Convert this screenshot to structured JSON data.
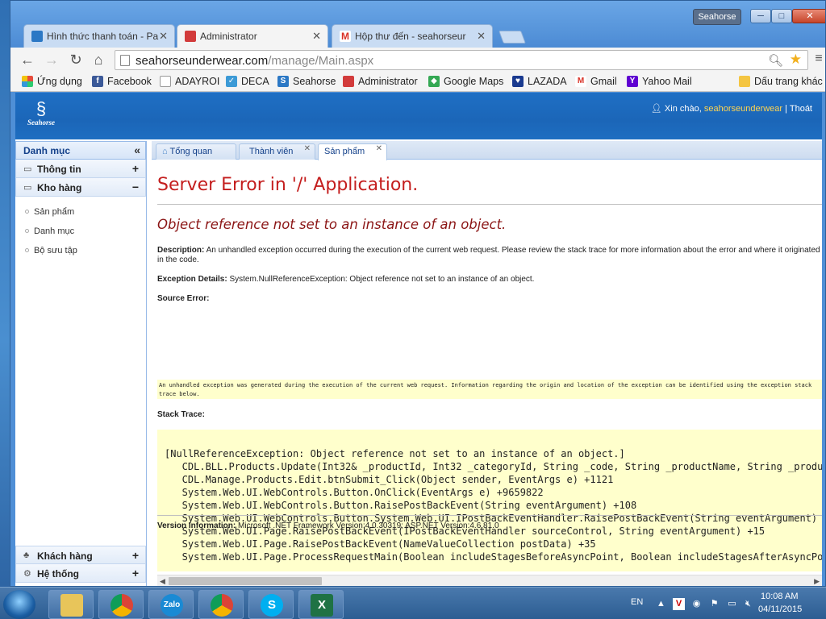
{
  "window": {
    "profile": "Seahorse",
    "controls": {
      "minimize": "─",
      "maximize": "□",
      "close": "✕"
    }
  },
  "tabs": [
    {
      "title": "Hình thức thanh toán - Pa",
      "icon": "seahorse-icon"
    },
    {
      "title": "Administrator",
      "icon": "admin-icon"
    },
    {
      "title": "Hộp thư đến - seahorseur",
      "icon": "gmail-icon"
    }
  ],
  "address_bar": {
    "host": "seahorseunderwear.com",
    "path": "/manage/Main.aspx"
  },
  "bookmarks": [
    {
      "label": "Ứng dụng",
      "icon": "apps-icon"
    },
    {
      "label": "Facebook",
      "icon": "facebook-icon"
    },
    {
      "label": "ADAYROI",
      "icon": "page-icon"
    },
    {
      "label": "DECA",
      "icon": "deca-icon"
    },
    {
      "label": "Seahorse",
      "icon": "seahorse-icon"
    },
    {
      "label": "Administrator",
      "icon": "admin-icon"
    },
    {
      "label": "Google Maps",
      "icon": "maps-icon"
    },
    {
      "label": "LAZADA",
      "icon": "lazada-icon"
    },
    {
      "label": "Gmail",
      "icon": "gmail-icon"
    },
    {
      "label": "Yahoo Mail",
      "icon": "yahoo-icon"
    },
    {
      "label": "Dấu trang khác",
      "icon": "folder-icon"
    }
  ],
  "app_header": {
    "brand": "Seahorse",
    "greeting": "Xin chào, ",
    "username": "seahorseunderwear",
    "separator": " | ",
    "logout": "Thoát"
  },
  "sidebar": {
    "title": "Danh mục",
    "collapse": "«",
    "sections": [
      {
        "label": "Thông tin",
        "toggle": "+",
        "icon": "monitor-icon"
      },
      {
        "label": "Kho hàng",
        "toggle": "−",
        "icon": "monitor-icon"
      }
    ],
    "items": [
      "Sản phẩm",
      "Danh mục",
      "Bộ sưu tập"
    ],
    "bottom_sections": [
      {
        "label": "Khách hàng",
        "toggle": "+",
        "icon": "users-icon"
      },
      {
        "label": "Hệ thống",
        "toggle": "+",
        "icon": "gear-icon"
      }
    ]
  },
  "content_tabs": [
    {
      "label": "Tổng quan",
      "closable": false
    },
    {
      "label": "Thành viên",
      "closable": true
    },
    {
      "label": "Sản phẩm",
      "closable": true
    }
  ],
  "error": {
    "title": "Server Error in '/' Application.",
    "subtitle": "Object reference not set to an instance of an object.",
    "description_label": "Description:",
    "description_text": " An unhandled exception occurred during the execution of the current web request. Please review the stack trace for more information about the error and where it originated in the code.",
    "exception_label": "Exception Details:",
    "exception_text": " System.NullReferenceException: Object reference not set to an instance of an object.",
    "source_label": "Source Error:",
    "source_text": "An unhandled exception was generated during the execution of the current web request. Information regarding the origin and location of the exception can be identified using the exception stack trace below.",
    "stack_label": "Stack Trace:",
    "stack_lines": [
      "[NullReferenceException: Object reference not set to an instance of an object.]",
      "   CDL.BLL.Products.Update(Int32& _productId, Int32 _categoryId, String _code, String _productName, String _produ",
      "   CDL.Manage.Products.Edit.btnSubmit_Click(Object sender, EventArgs e) +1121",
      "   System.Web.UI.WebControls.Button.OnClick(EventArgs e) +9659822",
      "   System.Web.UI.WebControls.Button.RaisePostBackEvent(String eventArgument) +108",
      "   System.Web.UI.WebControls.Button.System.Web.UI.IPostBackEventHandler.RaisePostBackEvent(String eventArgument) +",
      "   System.Web.UI.Page.RaisePostBackEvent(IPostBackEventHandler sourceControl, String eventArgument) +15",
      "   System.Web.UI.Page.RaisePostBackEvent(NameValueCollection postData) +35",
      "   System.Web.UI.Page.ProcessRequestMain(Boolean includeStagesBeforeAsyncPoint, Boolean includeStagesAfterAsyncPo"
    ],
    "version_label": "Version Information:",
    "version_text": " Microsoft .NET Framework Version:4.0.30319; ASP.NET Version:4.6.81.0"
  },
  "taskbar": {
    "apps": [
      "explorer-icon",
      "chrome-icon",
      "zalo-icon",
      "chrome-icon",
      "skype-icon",
      "excel-icon"
    ],
    "zalo_label": "Zalo",
    "skype_label": "S",
    "excel_label": "X",
    "language": "EN",
    "time": "10:08 AM",
    "date": "04/11/2015"
  },
  "colors": {
    "error_red": "#c41e1e",
    "header_blue": "#1f6fc4",
    "trace_bg": "#ffffcc",
    "username_yellow": "#ffd451"
  }
}
